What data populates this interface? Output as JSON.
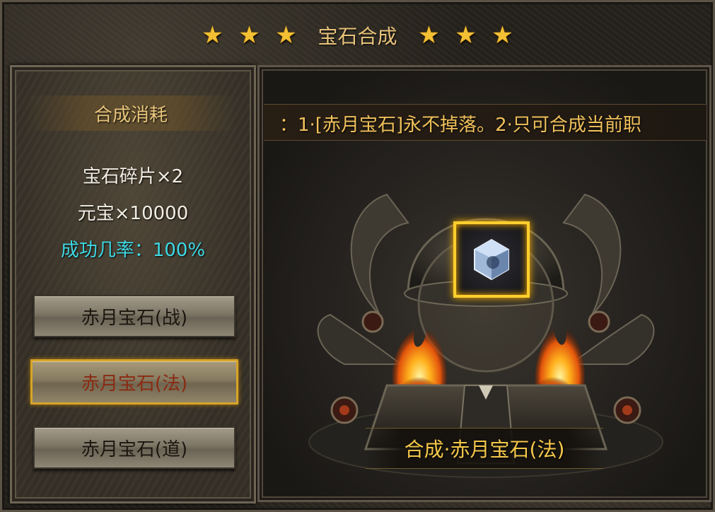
{
  "title": {
    "stars_left": [
      "★",
      "★",
      "★"
    ],
    "text": "宝石合成",
    "stars_right": [
      "★",
      "★",
      "★"
    ]
  },
  "left_panel": {
    "header": "合成消耗",
    "costs": [
      "宝石碎片×2",
      "元宝×10000"
    ],
    "success_rate": "成功几率：100%",
    "options": [
      {
        "label": "赤月宝石(战)",
        "selected": false
      },
      {
        "label": "赤月宝石(法)",
        "selected": true
      },
      {
        "label": "赤月宝石(道)",
        "selected": false
      }
    ]
  },
  "right_panel": {
    "notice": "：1·[赤月宝石]永不掉落。2·只可合成当前职",
    "gem_icon": "blue-crystal-gem-icon",
    "synth_button": "合成·赤月宝石(法)"
  },
  "colors": {
    "title_gold": "#e7c27a",
    "rate_cyan": "#3fd8e4",
    "selected_text": "#8a2a12",
    "notice_gold": "#f0c15b",
    "frame_gold": "#ffcf2e"
  }
}
